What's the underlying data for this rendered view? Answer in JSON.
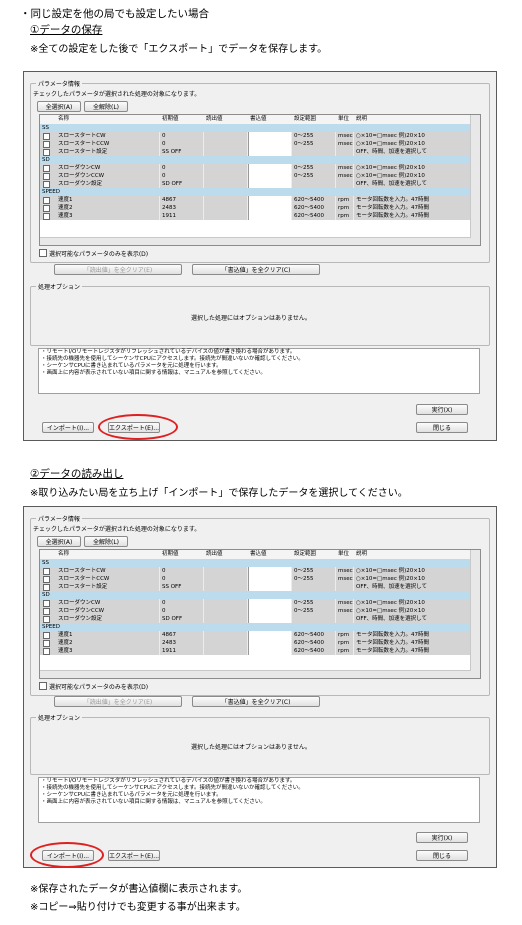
{
  "intro_heading": "・同じ設定を他の局でも設定したい場合",
  "section1": {
    "title": "①データの保存",
    "note": "※全ての設定をした後で「エクスポート」でデータを保存します。"
  },
  "section2": {
    "title": "②データの読み出し",
    "note": "※取り込みたい局を立ち上げ「インポート」で保存したデータを選択してください。"
  },
  "footer_notes": [
    "※保存されたデータが書込値欄に表示されます。",
    "※コピー⇒貼り付けでも変更する事が出来ます。"
  ],
  "dialog": {
    "param_group_title": "パラメータ情報",
    "param_instruction": "チェックしたパラメータが選択された処理の対象になります。",
    "select_all": "全選択(A)",
    "deselect_all": "全解除(L)",
    "columns": [
      "名称",
      "初期値",
      "読出値",
      "書込値",
      "設定範囲",
      "単位",
      "説明"
    ],
    "categories": {
      "ss": {
        "label": "SS",
        "rows": [
          {
            "name": "スロースタートCW",
            "initial": "0",
            "range": "0～255",
            "unit": "msec",
            "desc": "○×10=□msec 例)20×10"
          },
          {
            "name": "スロースタートCCW",
            "initial": "0",
            "range": "0～255",
            "unit": "msec",
            "desc": "○×10=□msec 例)20×10"
          },
          {
            "name": "スロースタート設定",
            "initial": "SS OFF",
            "range": "",
            "unit": "",
            "desc": "OFF、時間、加速を選択して"
          }
        ]
      },
      "sd": {
        "label": "SD",
        "rows": [
          {
            "name": "スローダウンCW",
            "initial": "0",
            "range": "0～255",
            "unit": "msec",
            "desc": "○×10=□msec 例)20×10"
          },
          {
            "name": "スローダウンCCW",
            "initial": "0",
            "range": "0～255",
            "unit": "msec",
            "desc": "○×10=□msec 例)20×10"
          },
          {
            "name": "スローダウン設定",
            "initial": "SD OFF",
            "range": "",
            "unit": "",
            "desc": "OFF、時間、加速を選択して"
          }
        ]
      },
      "speed": {
        "label": "SPEED",
        "rows": [
          {
            "name": "速度1",
            "initial": "4867",
            "range": "620～5400",
            "unit": "rpm",
            "desc": "モータ回転数を入力。47時間"
          },
          {
            "name": "速度2",
            "initial": "2483",
            "range": "620～5400",
            "unit": "rpm",
            "desc": "モータ回転数を入力。47時間"
          },
          {
            "name": "速度3",
            "initial": "1911",
            "range": "620～5400",
            "unit": "rpm",
            "desc": "モータ回転数を入力。47時間"
          }
        ]
      }
    },
    "show_selectable_only": "選択可能なパラメータのみを表示(D)",
    "clear_read": "「読出値」を全クリア(E)",
    "clear_write": "「書込値」を全クリア(C)",
    "process_group_title": "処理オプション",
    "no_option_text": "選択した処理にはオプションはありません。",
    "info_lines": [
      "・リモートI/Oリモートレジスタがリフレッシュされているデバイスの値が書き換わる場合があります。",
      "・接続先の機器先を使用してシーケンサCPUにアクセスします。接続先が間違いないか確認してください。",
      "・シーケンサCPUに書き込まれているパラメータを元に処理を行います。",
      "・画面上に内容が表示されていない項目に関する情報は、マニュアルを参照してください。"
    ],
    "execute": "実行(X)",
    "import": "インポート(I)...",
    "export": "エクスポート(E)...",
    "close": "閉じる"
  },
  "colors": {
    "highlight_oval": "#e02020",
    "category_row": "#bcdcee",
    "readonly_cell": "#d4d4d4"
  }
}
